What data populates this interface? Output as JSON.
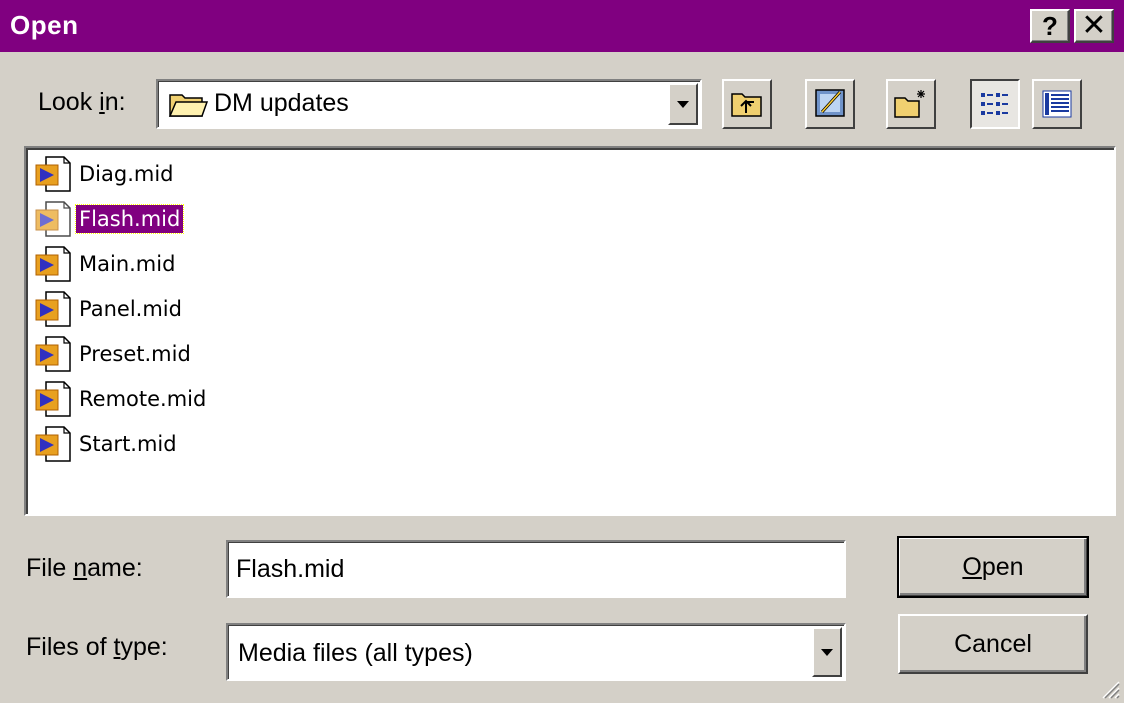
{
  "window": {
    "title": "Open",
    "help_glyph": "?",
    "close_glyph": "✕",
    "title_bar_color": "#800080"
  },
  "lookin": {
    "label_prefix": "Look ",
    "label_accel": "i",
    "label_suffix": "n:",
    "value": "DM updates",
    "icon": "folder-icon"
  },
  "toolbar": {
    "buttons": [
      {
        "name": "up-one-level-button",
        "icon": "up-folder-icon"
      },
      {
        "name": "go-to-desktop-button",
        "icon": "desktop-icon"
      },
      {
        "name": "create-new-folder-button",
        "icon": "new-folder-icon"
      },
      {
        "name": "list-view-button",
        "icon": "list-view-icon",
        "pressed": true
      },
      {
        "name": "details-view-button",
        "icon": "details-view-icon"
      }
    ]
  },
  "files": [
    {
      "name": "Diag.mid",
      "selected": false
    },
    {
      "name": "Flash.mid",
      "selected": true
    },
    {
      "name": "Main.mid",
      "selected": false
    },
    {
      "name": "Panel.mid",
      "selected": false
    },
    {
      "name": "Preset.mid",
      "selected": false
    },
    {
      "name": "Remote.mid",
      "selected": false
    },
    {
      "name": "Start.mid",
      "selected": false
    }
  ],
  "filename": {
    "label_prefix": "File ",
    "label_accel": "n",
    "label_suffix": "ame:",
    "value": "Flash.mid"
  },
  "filetype": {
    "label_prefix": "Files of ",
    "label_accel": "t",
    "label_suffix": "ype:",
    "value": "Media files (all types)"
  },
  "buttons": {
    "open_accel": "O",
    "open_rest": "pen",
    "cancel": "Cancel"
  },
  "colors": {
    "selection": "#800080",
    "face": "#d4d0c8"
  }
}
